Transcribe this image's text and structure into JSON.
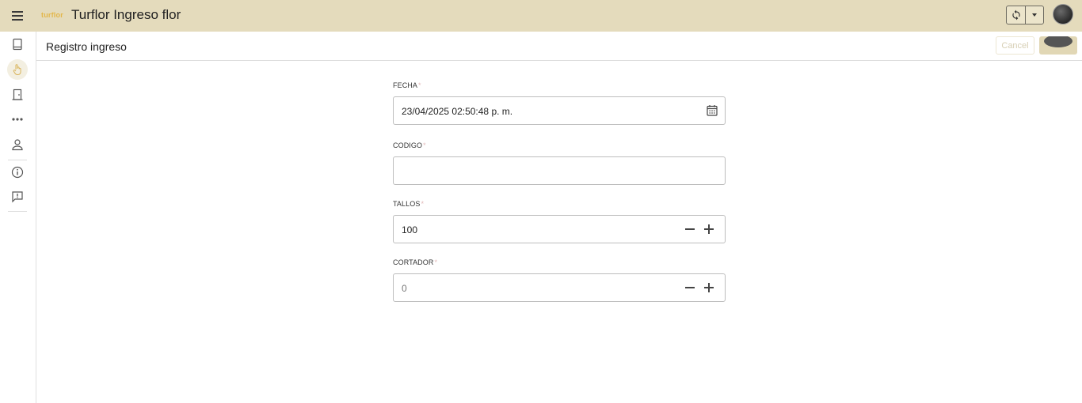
{
  "app": {
    "logo_text": "turflor",
    "title": "Turflor Ingreso flor"
  },
  "header": {
    "sync_icon": "sync-icon",
    "dropdown_icon": "chevron-down-icon"
  },
  "sidebar": {
    "items": [
      {
        "icon": "book-icon"
      },
      {
        "icon": "hand-pointer-icon"
      },
      {
        "icon": "door-exit-icon"
      },
      {
        "icon": "more-dots-icon"
      },
      {
        "icon": "user-icon"
      },
      {
        "icon": "info-icon"
      },
      {
        "icon": "feedback-icon"
      }
    ]
  },
  "page": {
    "title": "Registro ingreso",
    "cancel_label": "Cancel"
  },
  "form": {
    "fecha": {
      "label": "FECHA",
      "required": "*",
      "value": "23/04/2025 02:50:48 p. m."
    },
    "codigo": {
      "label": "CODIGO",
      "required": "*",
      "value": ""
    },
    "tallos": {
      "label": "TALLOS",
      "required": "*",
      "value": "100"
    },
    "cortador": {
      "label": "CORTADOR",
      "required": "*",
      "placeholder": "0"
    }
  },
  "colors": {
    "appbar": "#e4dbbc",
    "accent": "#e3b74a",
    "required": "#e2b8b8"
  }
}
